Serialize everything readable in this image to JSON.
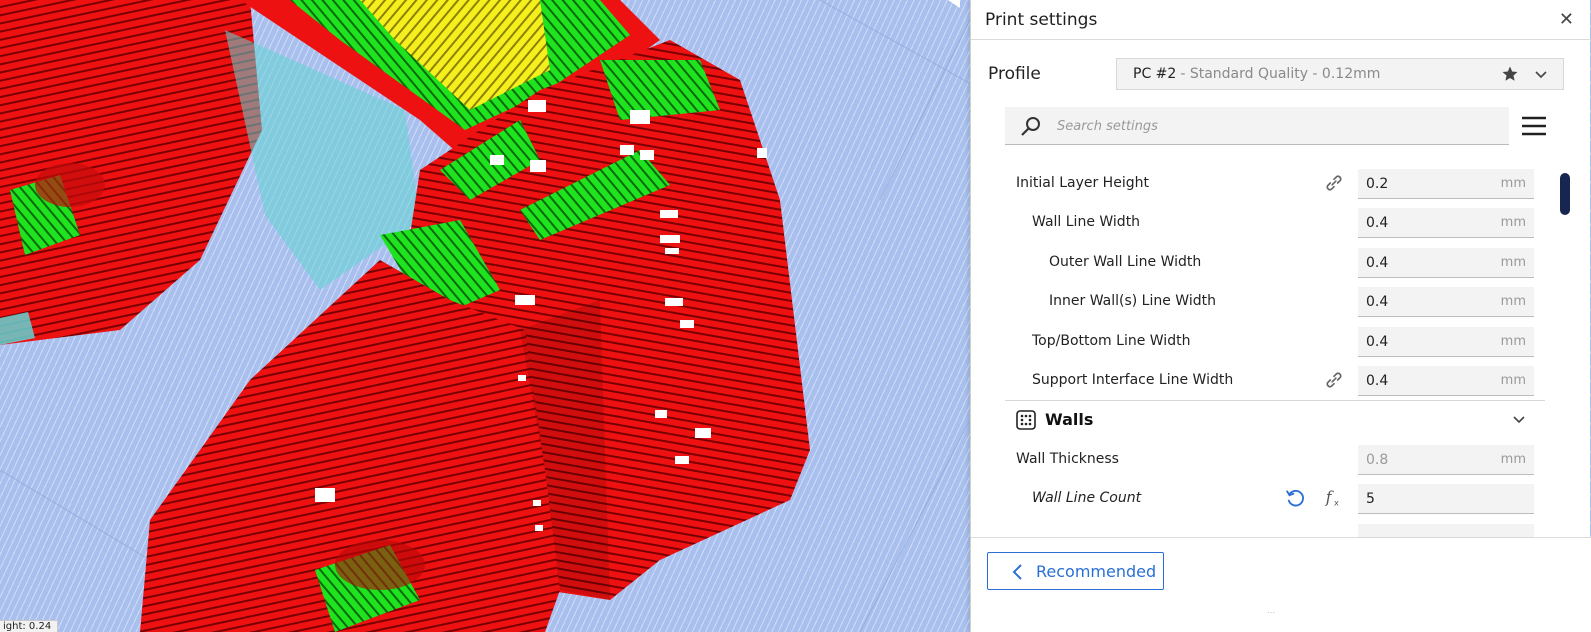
{
  "viewport": {
    "layer_readout": "ight: 0.24",
    "colors": {
      "wall": "#f01010",
      "infill": "#1fe31f",
      "top_skin": "#f5ef1b",
      "support": "#63d4d4",
      "build_plate": "#a9c0ee",
      "seam": "#ffffff"
    }
  },
  "panel": {
    "title": "Print settings",
    "close_icon": "close-icon",
    "profile": {
      "label": "Profile",
      "name": "PC #2",
      "detail": "- Standard Quality - 0.12mm",
      "icons": [
        "star-icon",
        "chevron-down-icon"
      ]
    },
    "search": {
      "placeholder": "Search settings",
      "value": ""
    },
    "settings": [
      {
        "label": "Initial Layer Height",
        "value": "0.2",
        "unit": "mm",
        "icon": "link-icon"
      },
      {
        "label": "Wall Line Width",
        "value": "0.4",
        "unit": "mm"
      },
      {
        "label": "Outer Wall Line Width",
        "value": "0.4",
        "unit": "mm"
      },
      {
        "label": "Inner Wall(s) Line Width",
        "value": "0.4",
        "unit": "mm"
      },
      {
        "label": "Top/Bottom Line Width",
        "value": "0.4",
        "unit": "mm"
      },
      {
        "label": "Support Interface Line Width",
        "value": "0.4",
        "unit": "mm",
        "icon": "link-icon"
      }
    ],
    "category": {
      "label": "Walls",
      "icon": "walls-icon",
      "settings": [
        {
          "label": "Wall Thickness",
          "value": "0.8",
          "unit": "mm"
        },
        {
          "label": "Wall Line Count",
          "value": "5",
          "unit": "",
          "icons": [
            "reset-icon",
            "function-icon"
          ]
        }
      ]
    },
    "footer": {
      "button_label": "Recommended",
      "resize_grip": "⋯"
    }
  }
}
